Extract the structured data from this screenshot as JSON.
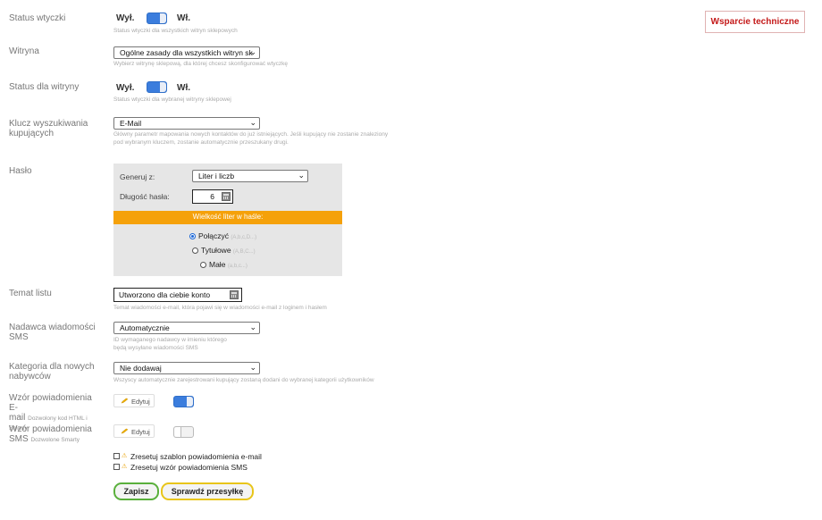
{
  "support_button": "Wsparcie techniczne",
  "status_plugin": {
    "label": "Status wtyczki",
    "off": "Wył.",
    "on": "Wł.",
    "help": "Status wtyczki dla wszystkich witryn sklepowych",
    "toggle_on": true
  },
  "store": {
    "label": "Witryna",
    "value": "Ogólne zasady dla wszystkich witryn sk",
    "help": "Wybierz witrynę sklepową, dla której chcesz skonfigurować wtyczkę"
  },
  "status_store": {
    "label": "Status dla witryny",
    "off": "Wył.",
    "on": "Wł.",
    "help": "Status wtyczki dla wybranej witryny sklepowej",
    "toggle_on": true
  },
  "search_key": {
    "label_line1": "Klucz wyszukiwania",
    "label_line2": "kupujących",
    "value": "E-Mail",
    "help_line1": "Główny parametr mapowania nowych kontaktów do już istniejących. Jeśli kupujący nie zostanie znaleziony",
    "help_line2": "pod wybranym kluczem, zostanie automatycznie przeszukany drugi."
  },
  "password": {
    "label": "Hasło",
    "generate_label": "Generuj z:",
    "generate_value": "Liter i liczb",
    "length_label": "Długość hasła:",
    "length_value": "6",
    "case_title": "Wielkość liter w haśle:",
    "options": [
      {
        "label": "Połączyć",
        "hint": "(A,b,c,D...)",
        "selected": true
      },
      {
        "label": "Tytułowe",
        "hint": "(A,B,C...)",
        "selected": false
      },
      {
        "label": "Małe",
        "hint": "(a,b,c...)",
        "selected": false
      }
    ]
  },
  "subject": {
    "label": "Temat listu",
    "value": "Utworzono dla ciebie konto",
    "help": "Temat wiadomości e-mail, która pojawi się w wiadomości e-mail z loginem i hasłem"
  },
  "sms_sender": {
    "label_line1": "Nadawca wiadomości",
    "label_line2": "SMS",
    "value": "Automatycznie",
    "help_line1": "ID wymaganego nadawcy w imieniu którego",
    "help_line2": "będą wysyłane wiadomości SMS"
  },
  "category": {
    "label_line1": "Kategoria dla nowych",
    "label_line2": "nabywców",
    "value": "Nie dodawaj",
    "help": "Wszyscy automatycznie zarejestrowani kupujący zostaną dodani do wybranej kategorii użytkowników"
  },
  "email_template": {
    "label_line1": "Wzór powiadomienia E-",
    "label_line2a": "mail",
    "label_line2b": "Dozwolony kod HTML i",
    "label_line3": "Smarty",
    "edit": "Edytuj",
    "toggle_on": true
  },
  "sms_template": {
    "label_line1": "Wzór powiadomienia",
    "label_line2a": "SMS",
    "label_line2b": "Dozwolone Smarty",
    "edit": "Edytuj",
    "toggle_on": false
  },
  "reset_email": "Zresetuj szablon powiadomienia e-mail",
  "reset_sms": "Zresetuj wzór powiadomienia SMS",
  "save_button": "Zapisz",
  "check_button": "Sprawdź przesyłkę"
}
